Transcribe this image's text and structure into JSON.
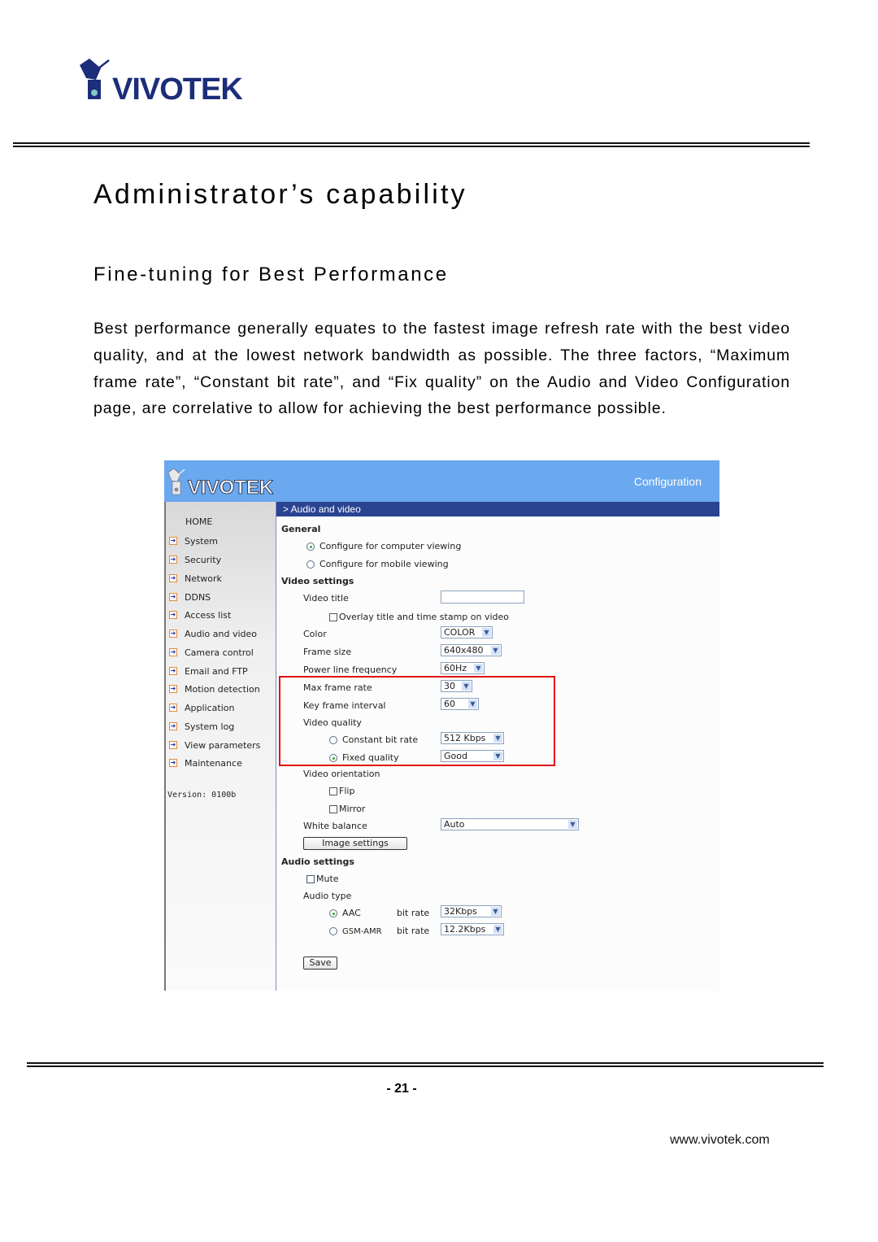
{
  "page": {
    "brand": "VIVOTEK",
    "heading": "Administrator’s capability",
    "subheading": "Fine-tuning for Best Performance",
    "paragraph": "Best performance generally equates to the fastest image refresh rate with the best video quality, and at the lowest network bandwidth as possible. The three factors, “Maximum frame rate”, “Constant bit rate”, and “Fix quality” on the Audio and Video Configuration page, are correlative to allow for achieving the best performance possible.",
    "page_number": "- 21 -",
    "website": "www.vivotek.com"
  },
  "screenshot": {
    "brand": "VIVOTEK",
    "header_title": "Configuration",
    "breadcrumb": "> Audio and video",
    "highlight_color": "#e01010",
    "header_color": "#6aa8ef",
    "breadcrumb_color": "#2a4491",
    "sidebar": {
      "home": "HOME",
      "items": [
        {
          "label": "System",
          "icon": "arrow-right-icon"
        },
        {
          "label": "Security",
          "icon": "arrow-right-icon"
        },
        {
          "label": "Network",
          "icon": "arrow-right-icon"
        },
        {
          "label": "DDNS",
          "icon": "arrow-right-icon"
        },
        {
          "label": "Access list",
          "icon": "arrow-right-icon"
        },
        {
          "label": "Audio and video",
          "icon": "arrow-right-icon"
        },
        {
          "label": "Camera control",
          "icon": "arrow-right-icon"
        },
        {
          "label": "Email and FTP",
          "icon": "arrow-right-icon"
        },
        {
          "label": "Motion detection",
          "icon": "arrow-right-icon"
        },
        {
          "label": "Application",
          "icon": "arrow-right-icon"
        },
        {
          "label": "System log",
          "icon": "arrow-right-icon"
        },
        {
          "label": "View parameters",
          "icon": "arrow-right-icon"
        },
        {
          "label": "Maintenance",
          "icon": "arrow-right-icon"
        }
      ],
      "version": "Version: 0100b"
    },
    "general": {
      "title": "General",
      "computer_viewing": {
        "label": "Configure for computer viewing",
        "selected": true
      },
      "mobile_viewing": {
        "label": "Configure for mobile viewing",
        "selected": false
      }
    },
    "video": {
      "title": "Video settings",
      "video_title_label": "Video title",
      "video_title_value": "",
      "overlay_label": "Overlay title and time stamp on video",
      "overlay_checked": false,
      "color_label": "Color",
      "color_value": "COLOR",
      "frame_size_label": "Frame size",
      "frame_size_value": "640x480",
      "power_line_label": "Power line frequency",
      "power_line_value": "60Hz",
      "max_frame_rate_label": "Max frame rate",
      "max_frame_rate_value": "30",
      "key_frame_label": "Key frame interval",
      "key_frame_value": "60",
      "quality_label": "Video quality",
      "cbr_label": "Constant bit rate",
      "cbr_selected": false,
      "cbr_value": "512 Kbps",
      "fixed_label": "Fixed quality",
      "fixed_selected": true,
      "fixed_value": "Good",
      "orientation_label": "Video orientation",
      "flip_label": "Flip",
      "flip_checked": false,
      "mirror_label": "Mirror",
      "mirror_checked": false,
      "white_balance_label": "White balance",
      "white_balance_value": "Auto",
      "image_settings_button": "Image settings"
    },
    "audio": {
      "title": "Audio settings",
      "mute_label": "Mute",
      "mute_checked": false,
      "type_label": "Audio type",
      "aac_label": "AAC",
      "aac_selected": true,
      "aac_bitrate_label": "bit rate",
      "aac_bitrate_value": "32Kbps",
      "gsm_label": "GSM-AMR",
      "gsm_selected": false,
      "gsm_bitrate_label": "bit rate",
      "gsm_bitrate_value": "12.2Kbps"
    },
    "save_button": "Save"
  }
}
